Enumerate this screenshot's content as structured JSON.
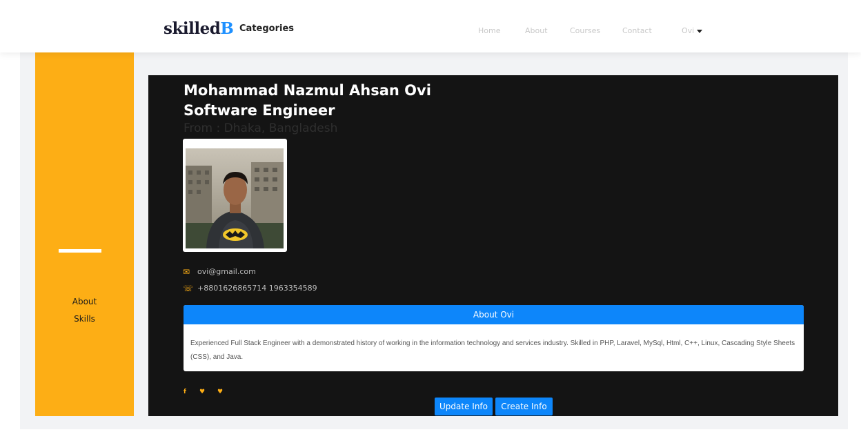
{
  "navbar": {
    "brand_main": "skilled",
    "brand_accent": "B",
    "categories": "Categories",
    "links": [
      "Home",
      "About",
      "Courses",
      "Contact"
    ],
    "user": "Ovi"
  },
  "sidebar": {
    "items": [
      {
        "label": "About",
        "active": true
      },
      {
        "label": "Skills",
        "active": false
      }
    ]
  },
  "profile": {
    "name": "Mohammad Nazmul Ahsan Ovi",
    "title": "Software Engineer",
    "from": "From : Dhaka, Bangladesh",
    "email": "ovi@gmail.com",
    "phone": "+8801626865714 1963354589",
    "email_icon": "envelope-icon",
    "phone_icon": "phone-icon"
  },
  "about_card": {
    "header": "About Ovi",
    "body": "Experienced Full Stack Engineer with a demonstrated history of working in the information technology and services industry. Skilled in PHP, Laravel, MySql, Html, C++, Linux, Cascading Style Sheets (CSS), and Java."
  },
  "social": {
    "icons": [
      "facebook-icon",
      "twitter-icon",
      "twitter-icon"
    ],
    "glyphs": [
      "f",
      "♥",
      "♥"
    ]
  },
  "actions": {
    "update_label": "Update Info",
    "create_label": "Create Info"
  },
  "colors": {
    "accent_yellow": "#fdae15",
    "primary_blue": "#0d86fa",
    "panel_dark": "#141414",
    "brand_blue": "#1e90ff"
  }
}
